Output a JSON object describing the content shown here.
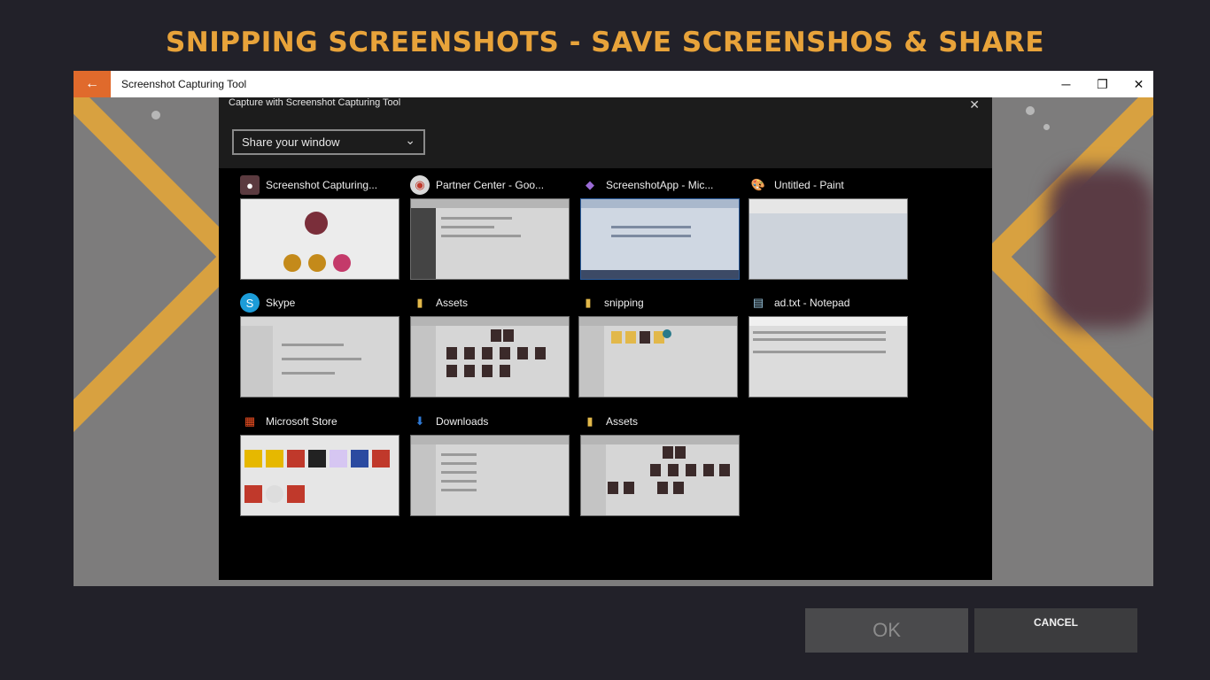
{
  "banner": {
    "title": "SNIPPING SCREENSHOTS - SAVE SCREENSHOS & SHARE"
  },
  "window": {
    "title": "Screenshot Capturing Tool",
    "back_icon": "arrow-left-icon",
    "controls": {
      "minimize": "─",
      "maximize": "❐",
      "close": "✕"
    }
  },
  "dialog": {
    "title": "Capture with Screenshot Capturing Tool",
    "close_glyph": "✕",
    "dropdown": {
      "selected": "Share your window"
    },
    "windows": [
      {
        "label": "Screenshot Capturing...",
        "icon": "app-avatar-icon"
      },
      {
        "label": "Partner Center - Goo...",
        "icon": "chrome-icon"
      },
      {
        "label": "ScreenshotApp - Mic...",
        "icon": "visual-studio-icon"
      },
      {
        "label": "Untitled - Paint",
        "icon": "paint-icon"
      },
      {
        "label": "Skype",
        "icon": "skype-icon"
      },
      {
        "label": "Assets",
        "icon": "folder-icon"
      },
      {
        "label": "snipping",
        "icon": "folder-icon"
      },
      {
        "label": "ad.txt - Notepad",
        "icon": "notepad-icon"
      },
      {
        "label": "Microsoft Store",
        "icon": "store-icon"
      },
      {
        "label": "Downloads",
        "icon": "download-icon"
      },
      {
        "label": "Assets",
        "icon": "folder-icon"
      }
    ]
  },
  "buttons": {
    "ok": "OK",
    "cancel": "CANCEL"
  },
  "colors": {
    "accent": "#e8a33a",
    "back_button": "#e06a2c"
  }
}
